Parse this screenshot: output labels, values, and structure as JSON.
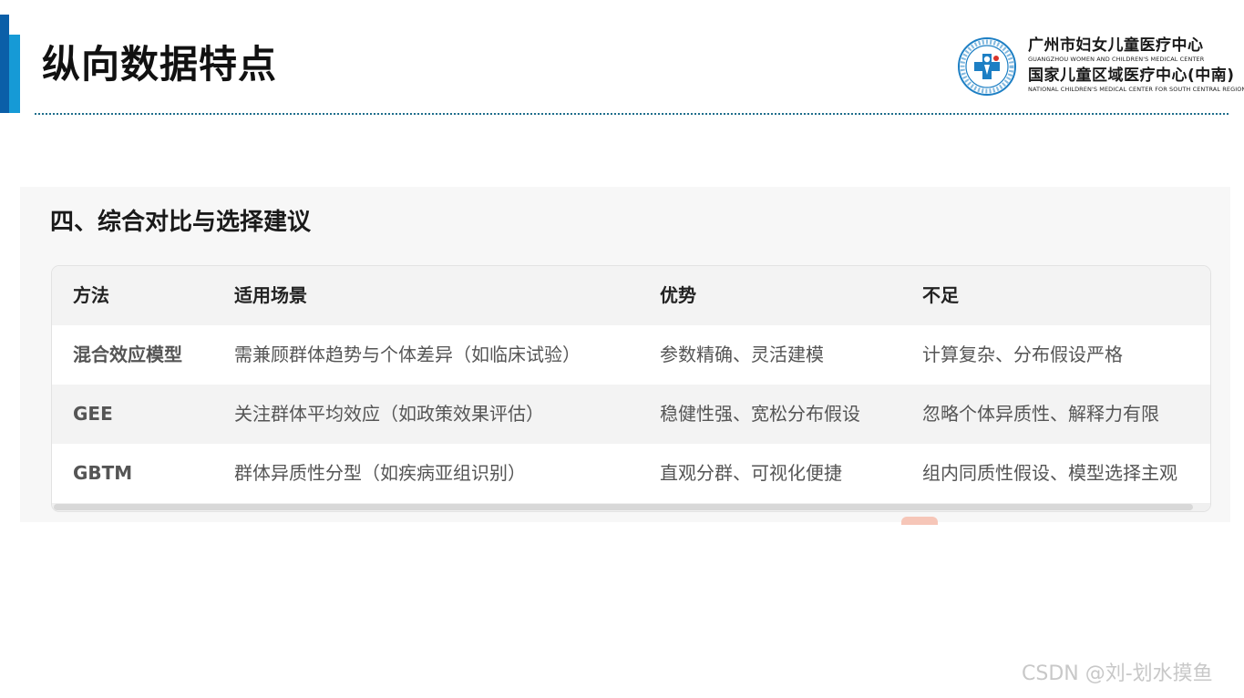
{
  "slide": {
    "title": "纵向数据特点"
  },
  "org": {
    "name_cn_1": "广州市妇女儿童医疗中心",
    "name_en_1": "GUANGZHOU WOMEN AND CHILDREN'S MEDICAL CENTER",
    "name_cn_2": "国家儿童区域医疗中心(中南)",
    "name_en_2": "NATIONAL CHILDREN'S MEDICAL CENTER FOR SOUTH CENTRAL REGION"
  },
  "section": {
    "title": "四、综合对比与选择建议"
  },
  "table": {
    "headers": [
      "方法",
      "适用场景",
      "优势",
      "不足"
    ],
    "rows": [
      [
        "混合效应模型",
        "需兼顾群体趋势与个体差异（如临床试验）",
        "参数精确、灵活建模",
        "计算复杂、分布假设严格"
      ],
      [
        "GEE",
        "关注群体平均效应（如政策效果评估）",
        "稳健性强、宽松分布假设",
        "忽略个体异质性、解释力有限"
      ],
      [
        "GBTM",
        "群体异质性分型（如疾病亚组识别）",
        "直观分群、可视化便捷",
        "组内同质性假设、模型选择主观"
      ]
    ]
  },
  "watermark": "CSDN @刘-划水摸鱼",
  "colors": {
    "accent_dark": "#0b5fa8",
    "accent_light": "#169ad6",
    "logo_blue": "#1d7fc4",
    "logo_red": "#d9342b"
  }
}
